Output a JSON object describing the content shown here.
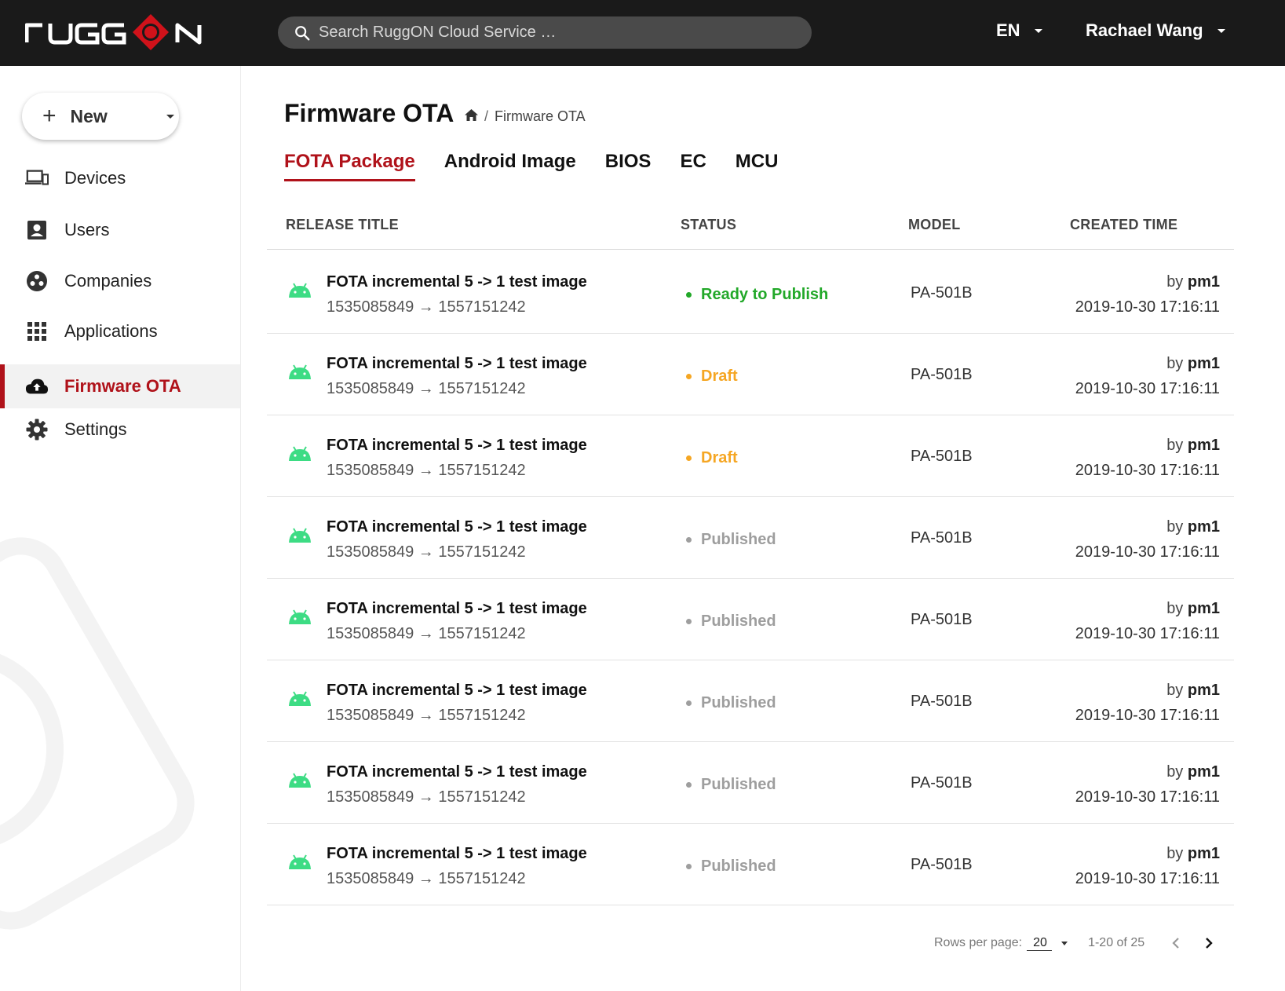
{
  "header": {
    "logo_text": "RUGGON",
    "search_placeholder": "Search RuggON Cloud Service …",
    "language": "EN",
    "user_name": "Rachael Wang"
  },
  "sidebar": {
    "new_label": "New",
    "items": [
      {
        "label": "Devices",
        "icon": "devices-icon"
      },
      {
        "label": "Users",
        "icon": "user-badge-icon"
      },
      {
        "label": "Companies",
        "icon": "companies-icon"
      },
      {
        "label": "Applications",
        "icon": "grid-icon"
      },
      {
        "label": "Firmware OTA",
        "icon": "cloud-upload-icon",
        "active": true
      },
      {
        "label": "Settings",
        "icon": "gear-icon"
      }
    ]
  },
  "page": {
    "title": "Firmware OTA",
    "breadcrumb": "Firmware OTA"
  },
  "tabs": [
    "FOTA Package",
    "Android Image",
    "BIOS",
    "EC",
    "MCU"
  ],
  "table": {
    "columns": [
      "RELEASE TITLE",
      "STATUS",
      "MODEL",
      "CREATED TIME"
    ],
    "rows": [
      {
        "title": "FOTA incremental 5 -> 1 test image",
        "versions": "1535085849 → 1557151242",
        "status": "Ready to Publish",
        "model": "PA-501B",
        "by_prefix": "by",
        "by": "pm1",
        "time": "2019-10-30 17:16:11"
      },
      {
        "title": "FOTA incremental 5 -> 1 test image",
        "versions": "1535085849 → 1557151242",
        "status": "Draft",
        "model": "PA-501B",
        "by_prefix": "by",
        "by": "pm1",
        "time": "2019-10-30 17:16:11"
      },
      {
        "title": "FOTA incremental 5 -> 1 test image",
        "versions": "1535085849 → 1557151242",
        "status": "Draft",
        "model": "PA-501B",
        "by_prefix": "by",
        "by": "pm1",
        "time": "2019-10-30 17:16:11"
      },
      {
        "title": "FOTA incremental 5 -> 1 test image",
        "versions": "1535085849 → 1557151242",
        "status": "Published",
        "model": "PA-501B",
        "by_prefix": "by",
        "by": "pm1",
        "time": "2019-10-30 17:16:11"
      },
      {
        "title": "FOTA incremental 5 -> 1 test image",
        "versions": "1535085849 → 1557151242",
        "status": "Published",
        "model": "PA-501B",
        "by_prefix": "by",
        "by": "pm1",
        "time": "2019-10-30 17:16:11"
      },
      {
        "title": "FOTA incremental 5 -> 1 test image",
        "versions": "1535085849 → 1557151242",
        "status": "Published",
        "model": "PA-501B",
        "by_prefix": "by",
        "by": "pm1",
        "time": "2019-10-30 17:16:11"
      },
      {
        "title": "FOTA incremental 5 -> 1 test image",
        "versions": "1535085849 → 1557151242",
        "status": "Published",
        "model": "PA-501B",
        "by_prefix": "by",
        "by": "pm1",
        "time": "2019-10-30 17:16:11"
      },
      {
        "title": "FOTA incremental 5 -> 1 test image",
        "versions": "1535085849 → 1557151242",
        "status": "Published",
        "model": "PA-501B",
        "by_prefix": "by",
        "by": "pm1",
        "time": "2019-10-30 17:16:11"
      }
    ]
  },
  "pagination": {
    "rows_per_page_label": "Rows per page:",
    "rows_per_page": "20",
    "range": "1-20 of 25"
  },
  "colors": {
    "brand_red": "#b0121a",
    "status_ready": "#22a829",
    "status_draft": "#f5a623",
    "status_published": "#9e9e9e",
    "android_green": "#3ddc84"
  }
}
